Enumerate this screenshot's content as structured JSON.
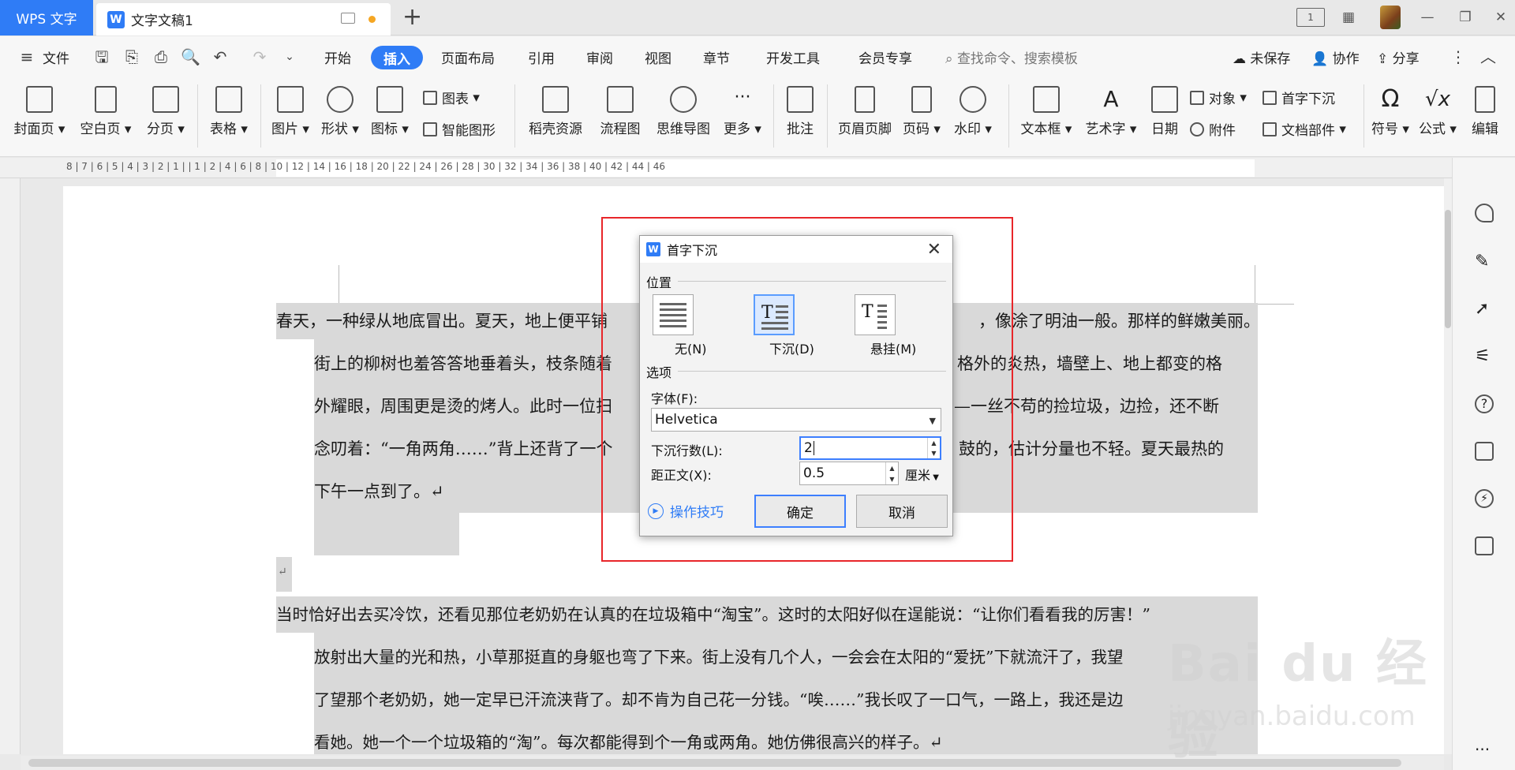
{
  "titlebar": {
    "app_tab": "WPS 文字",
    "doc_tab": "文字文稿1",
    "new_tab": "+"
  },
  "menubar": {
    "file": "文件",
    "tabs": [
      "开始",
      "插入",
      "页面布局",
      "引用",
      "审阅",
      "视图",
      "章节",
      "开发工具",
      "会员专享"
    ],
    "active_tab": "插入",
    "search_placeholder": "查找命令、搜索模板",
    "unsaved": "未保存",
    "collab": "协作",
    "share": "分享"
  },
  "ribbon": {
    "cover": "封面页",
    "blank": "空白页",
    "pagebreak": "分页",
    "table": "表格",
    "picture": "图片",
    "shape": "形状",
    "icons": "图标",
    "chart": "图表",
    "smartart": "智能图形",
    "docer": "稻壳资源",
    "flowchart": "流程图",
    "mindmap": "思维导图",
    "more": "更多",
    "comment": "批注",
    "header_footer": "页眉页脚",
    "page_number": "页码",
    "watermark": "水印",
    "textbox": "文本框",
    "wordart": "艺术字",
    "date": "日期",
    "object": "对象",
    "dropcap": "首字下沉",
    "attachment": "附件",
    "docparts": "文档部件",
    "symbol": "符号",
    "formula": "公式",
    "edit": "编辑"
  },
  "ruler": {
    "ticks": "8 | 7 | 6 | 5 | 4 | 3 | 2 | 1 |   | 1 | 2 | 4 | 6 | 8 | 10 | 12 | 14 | 16 | 18 | 20 | 22 | 24 | 26 | 28 | 30 | 32 | 34 | 36 | 38 | 40 | 42 | 44 | 46"
  },
  "document": {
    "para1_line1": "春天，一种绿从地底冒出。夏天，地上便平铺",
    "para1_line1_end": "，像涂了明油一般。那样的鲜嫩美丽。",
    "para1_line2": "街上的柳树也羞答答地垂着头，枝条随着",
    "para1_line2_end": "格外的炎热，墙壁上、地上都变的格",
    "para1_line3": "外耀眼，周围更是烫的烤人。此时一位扫",
    "para1_line3_end": "—一丝不苟的捡垃圾，边捡，还不断",
    "para1_line4": "念叨着：“一角两角……”背上还背了一个",
    "para1_line4_end": "鼓的，估计分量也不轻。夏天最热的",
    "para1_line5": "下午一点到了。↵",
    "empty_para": "↵",
    "para2_line1": "当时恰好出去买冷饮，还看见那位老奶奶在认真的在垃圾箱中“淘宝”。这时的太阳好似在逞能说：“让你们看看我的厉害！”",
    "para2_line2": "放射出大量的光和热，小草那挺直的身躯也弯了下来。街上没有几个人，一会会在太阳的“爱抚”下就流汗了，我望",
    "para2_line3": "了望那个老奶奶，她一定早已汗流浃背了。却不肯为自己花一分钱。“唉……”我长叹了一口气，一路上，我还是边",
    "para2_line4": "看她。她一个一个垃圾箱的“淘”。每次都能得到个一角或两角。她仿佛很高兴的样子。↵"
  },
  "dialog": {
    "title": "首字下沉",
    "position_group": "位置",
    "pos_none": "无(N)",
    "pos_dropped": "下沉(D)",
    "pos_margin": "悬挂(M)",
    "selected_position": "下沉(D)",
    "options_group": "选项",
    "font_label": "字体(F):",
    "font_value": "Helvetica",
    "lines_label": "下沉行数(L):",
    "lines_value": "2",
    "distance_label": "距正文(X):",
    "distance_value": "0.5",
    "unit_value": "厘米",
    "tips": "操作技巧",
    "ok": "确定",
    "cancel": "取消"
  },
  "colors": {
    "accent": "#2f7cf6",
    "annotation_border": "#e8262a",
    "selection_highlight": "#d9d9d9"
  },
  "watermark": {
    "brand": "Bai du 经验",
    "url": "jingyan.baidu.com"
  }
}
